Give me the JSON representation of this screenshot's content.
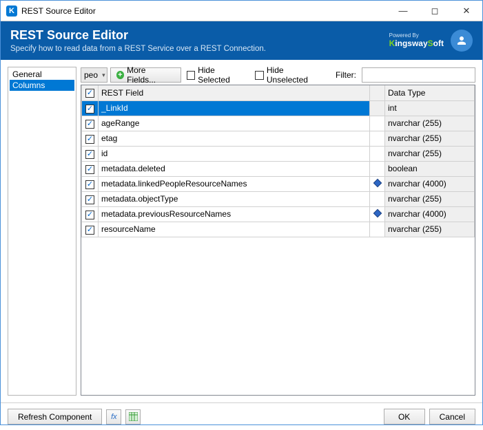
{
  "titlebar": {
    "title": "REST Source Editor"
  },
  "header": {
    "title": "REST Source Editor",
    "subtitle": "Specify how to read data from a REST Service over a REST Connection.",
    "brand_powered": "Powered By",
    "brand_name": "KingswaySoft"
  },
  "sidebar": {
    "items": [
      {
        "label": "General",
        "selected": false
      },
      {
        "label": "Columns",
        "selected": true
      }
    ]
  },
  "toolbar": {
    "combo_value": "peo",
    "more_fields": "More Fields...",
    "hide_selected": "Hide Selected",
    "hide_unselected": "Hide Unselected",
    "filter_label": "Filter:",
    "filter_value": ""
  },
  "grid": {
    "headers": {
      "field": "REST Field",
      "type": "Data Type"
    },
    "rows": [
      {
        "checked": true,
        "field": "_LinkId",
        "type": "int",
        "icon": false,
        "selected": true
      },
      {
        "checked": true,
        "field": "ageRange",
        "type": "nvarchar (255)",
        "icon": false,
        "selected": false
      },
      {
        "checked": true,
        "field": "etag",
        "type": "nvarchar (255)",
        "icon": false,
        "selected": false
      },
      {
        "checked": true,
        "field": "id",
        "type": "nvarchar (255)",
        "icon": false,
        "selected": false
      },
      {
        "checked": true,
        "field": "metadata.deleted",
        "type": "boolean",
        "icon": false,
        "selected": false
      },
      {
        "checked": true,
        "field": "metadata.linkedPeopleResourceNames",
        "type": "nvarchar (4000)",
        "icon": true,
        "selected": false
      },
      {
        "checked": true,
        "field": "metadata.objectType",
        "type": "nvarchar (255)",
        "icon": false,
        "selected": false
      },
      {
        "checked": true,
        "field": "metadata.previousResourceNames",
        "type": "nvarchar (4000)",
        "icon": true,
        "selected": false
      },
      {
        "checked": true,
        "field": "resourceName",
        "type": "nvarchar (255)",
        "icon": false,
        "selected": false
      }
    ]
  },
  "footer": {
    "refresh": "Refresh Component",
    "ok": "OK",
    "cancel": "Cancel"
  }
}
